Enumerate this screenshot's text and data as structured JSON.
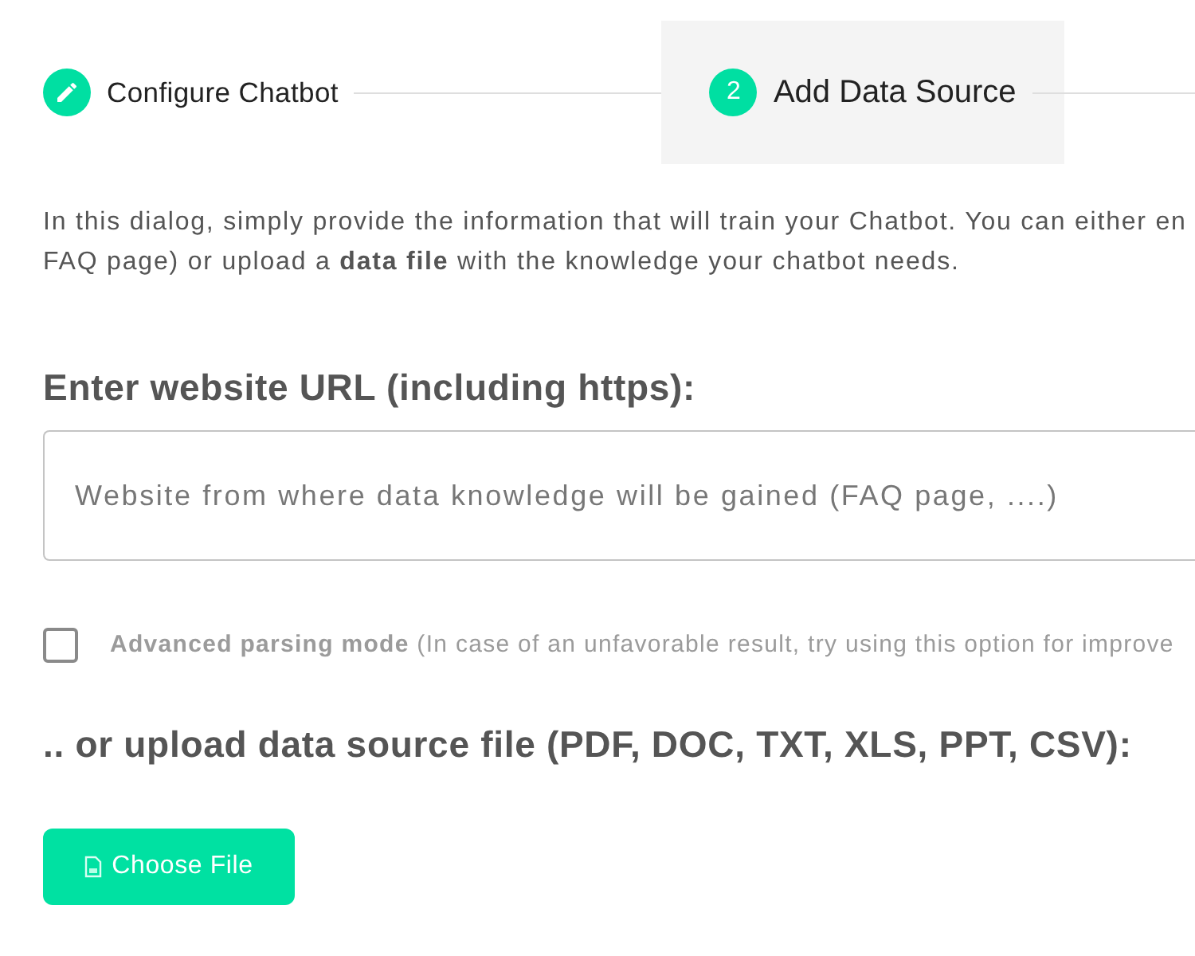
{
  "stepper": {
    "steps": [
      {
        "kind": "done",
        "label": "Configure Chatbot",
        "selected": false
      },
      {
        "kind": "number",
        "number": "2",
        "label": "Add Data Source",
        "selected": true
      }
    ]
  },
  "intro": {
    "lines": [
      "In this dialog, simply provide the information that will train your Chatbot. You can either en",
      "FAQ page) or upload a **data file** with the knowledge your chatbot needs."
    ]
  },
  "url_section": {
    "heading": "Enter website URL (including https):",
    "url_field": {
      "placeholder": "Website from where data knowledge will be gained (FAQ page, ....)"
    }
  },
  "advanced_option": {
    "checked": false,
    "label": "**Advanced parsing mode** (In case of an unfavorable result, try using this option for improve"
  },
  "upload_section": {
    "heading": ".. or upload data source file (PDF, DOC, TXT, XLS, PPT, CSV):",
    "button": "Choose File"
  }
}
